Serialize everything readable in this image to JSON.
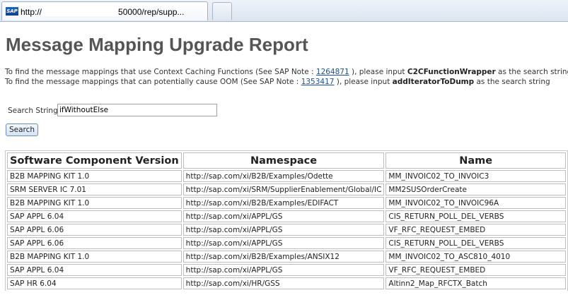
{
  "browser": {
    "favicon_label": "SAP",
    "url_prefix": "http://",
    "url_suffix": "50000/rep/supp..."
  },
  "page": {
    "title": "Message Mapping Upgrade Report",
    "info_lines": [
      {
        "before": "To find the message mappings that use Context Caching Functions (See SAP Note : ",
        "link": "1264871",
        "middle": " ), please input ",
        "keyword": "C2CFunctionWrapper",
        "after": " as the search string"
      },
      {
        "before": "To find the message mappings that can potentially cause OOM (See SAP Note : ",
        "link": "1353417",
        "middle": " ), please input ",
        "keyword": "addIteratorToDump",
        "after": " as the search string"
      }
    ],
    "search": {
      "label": "Search String:",
      "value": "ifWithoutElse",
      "button_label": "Search"
    }
  },
  "table": {
    "columns": [
      "Software Component Version",
      "Namespace",
      "Name"
    ],
    "rows": [
      [
        "B2B MAPPING KIT 1.0",
        "http://sap.com/xi/B2B/Examples/Odette",
        "MM_INVOIC02_TO_INVOIC3"
      ],
      [
        "SRM SERVER IC 7.01",
        "http://sap.com/xi/SRM/SupplierEnablement/Global/IC",
        "MM2SUSOrderCreate"
      ],
      [
        "B2B MAPPING KIT 1.0",
        "http://sap.com/xi/B2B/Examples/EDIFACT",
        "MM_INVOIC02_TO_INVOIC96A"
      ],
      [
        "SAP APPL 6.04",
        "http://sap.com/xi/APPL/GS",
        "CIS_RETURN_POLL_DEL_VERBS"
      ],
      [
        "SAP APPL 6.06",
        "http://sap.com/xi/APPL/GS",
        "VF_RFC_REQUEST_EMBED"
      ],
      [
        "SAP APPL 6.06",
        "http://sap.com/xi/APPL/GS",
        "CIS_RETURN_POLL_DEL_VERBS"
      ],
      [
        "B2B MAPPING KIT 1.0",
        "http://sap.com/xi/B2B/Examples/ANSIX12",
        "MM_INVOIC02_TO_ASC810_4010"
      ],
      [
        "SAP APPL 6.04",
        "http://sap.com/xi/APPL/GS",
        "VF_RFC_REQUEST_EMBED"
      ],
      [
        "SAP HR 6.04",
        "http://sap.com/xi/HR/GSS",
        "Altinn2_Map_RFCTX_Batch"
      ]
    ]
  }
}
